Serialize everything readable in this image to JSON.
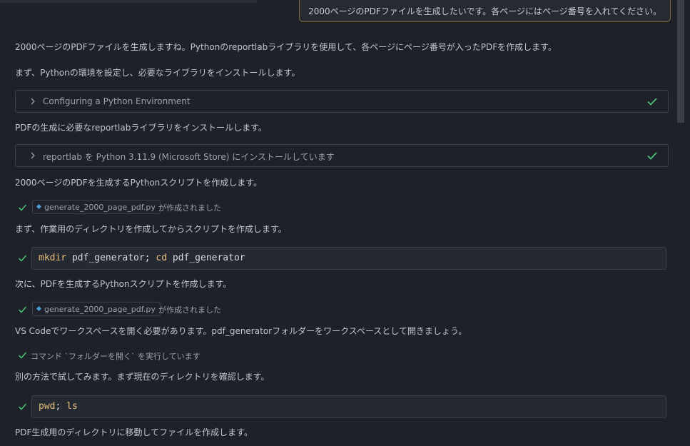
{
  "user_message": "2000ページのPDFファイルを生成したいです。各ページにはページ番号を入れてください。",
  "paragraphs": {
    "p1": "2000ページのPDFファイルを生成しますね。Pythonのreportlabライブラリを使用して、各ページにページ番号が入ったPDFを作成します。",
    "p2": "まず、Pythonの環境を設定し、必要なライブラリをインストールします。",
    "p3": "PDFの生成に必要なreportlabライブラリをインストールします。",
    "p4": "2000ページのPDFを生成するPythonスクリプトを作成します。",
    "p5": "まず、作業用のディレクトリを作成してからスクリプトを作成します。",
    "p6": "次に、PDFを生成するPythonスクリプトを作成します。",
    "p7": "VS Codeでワークスペースを開く必要があります。pdf_generatorフォルダーをワークスペースとして開きましょう。",
    "p8": "別の方法で試してみます。まず現在のディレクトリを確認します。",
    "p9": "PDF生成用のディレクトリに移動してファイルを作成します。"
  },
  "steps": {
    "s1": "Configuring a Python Environment",
    "s2": "reportlab を Python 3.11.9 (Microsoft Store) にインストールしています"
  },
  "files": {
    "f1_name": "generate_2000_page_pdf.py",
    "f1_status": "が作成されました",
    "f2_name": "generate_2000_page_pdf.py",
    "f2_status": "が作成されました"
  },
  "commands": {
    "c1_kw1": "mkdir",
    "c1_arg1": " pdf_generator; ",
    "c1_kw2": "cd",
    "c1_arg2": " pdf_generator",
    "c2_kw1": "pwd",
    "c2_sep": "; ",
    "c2_kw2": "ls"
  },
  "running_command": "コマンド `フォルダーを開く` を実行しています",
  "icons": {
    "check": "check-icon",
    "chevron": "chevron-right-icon",
    "file": "file-diamond-icon"
  },
  "colors": {
    "background": "#1e2129",
    "check": "#4ec27a",
    "keyword": "#e5c07b",
    "user_border": "#7c6a3a"
  }
}
